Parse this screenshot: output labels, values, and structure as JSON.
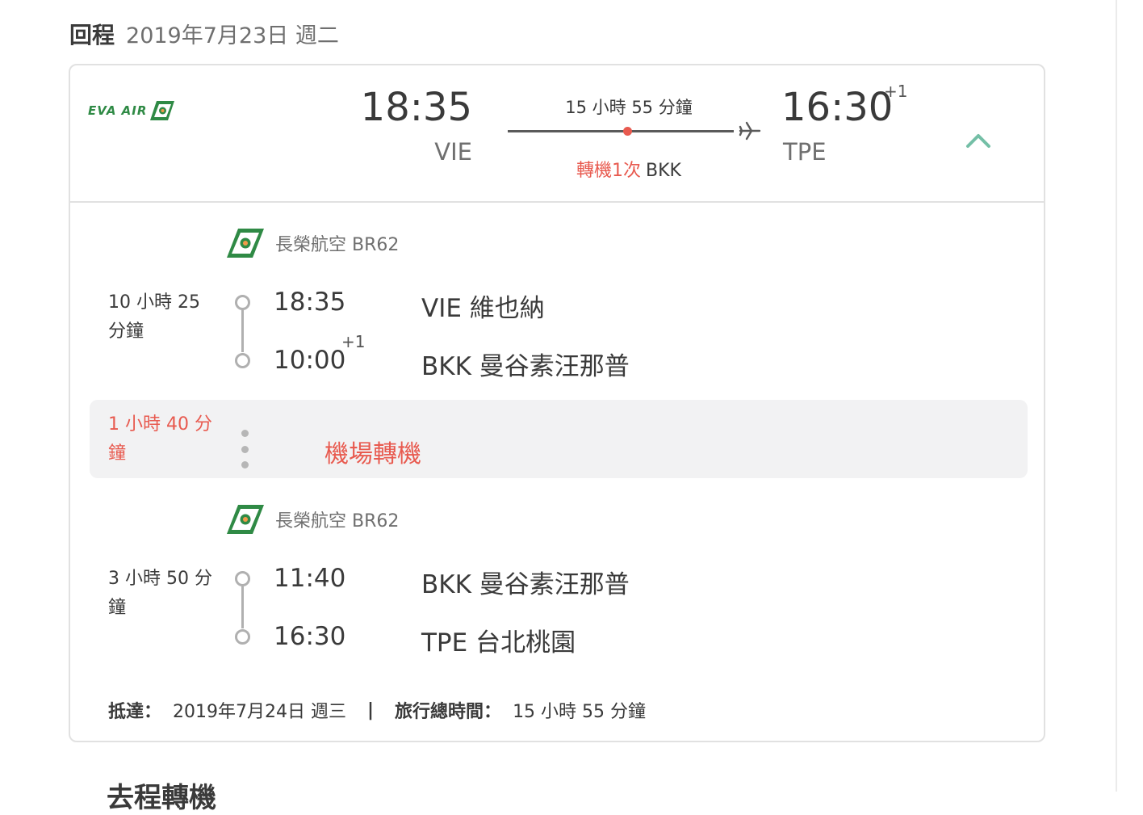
{
  "section": {
    "label": "回程",
    "date": "2019年7月23日 週二"
  },
  "summary": {
    "airline_logo_text": "EVA AIR",
    "departure": {
      "time": "18:35",
      "code": "VIE"
    },
    "arrival": {
      "time": "16:30",
      "day_offset": "+1",
      "code": "TPE"
    },
    "duration": "15 小時 55 分鐘",
    "stops": {
      "count_label": "轉機1次",
      "airport": "BKK"
    },
    "colors": {
      "accent_red": "#e85a4f",
      "brand_green": "#2f8a45",
      "chevron_teal": "#74bfa6"
    }
  },
  "segments": [
    {
      "airline": "長榮航空 BR62",
      "duration_line1": "10 小時 25",
      "duration_line2": "分鐘",
      "departure": {
        "time": "18:35",
        "airport": "VIE 維也納"
      },
      "arrival": {
        "time": "10:00",
        "day_offset": "+1",
        "airport": "BKK 曼谷素汪那普"
      }
    },
    {
      "airline": "長榮航空 BR62",
      "duration_line1": "3 小時 50 分",
      "duration_line2": "鐘",
      "departure": {
        "time": "11:40",
        "airport": "BKK 曼谷素汪那普"
      },
      "arrival": {
        "time": "16:30",
        "airport": "TPE 台北桃園"
      }
    }
  ],
  "layover": {
    "duration_line1": "1 小時 40 分",
    "duration_line2": "鐘",
    "label": "機場轉機"
  },
  "footer": {
    "arrival_label": "抵達：",
    "arrival_value": "2019年7月24日 週三",
    "separator": "|",
    "total_label": "旅行總時間：",
    "total_value": "15 小時 55 分鐘"
  },
  "next_section_heading": "去程轉機"
}
